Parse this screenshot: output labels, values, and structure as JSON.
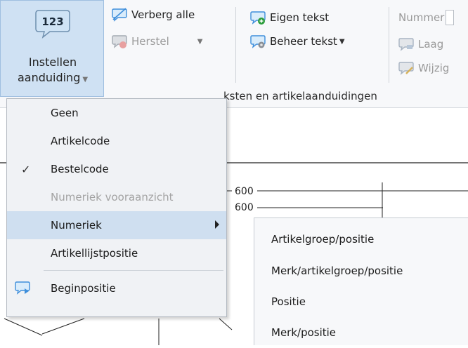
{
  "ribbon": {
    "big_button": {
      "icon_text": "123",
      "line1": "Instellen",
      "line2": "aanduiding"
    },
    "verberg_alle": "Verberg alle",
    "herstel": "Herstel",
    "eigen_tekst": "Eigen tekst",
    "beheer_tekst": "Beheer tekst",
    "nummer": "Nummer",
    "laag": "Laag",
    "wijzig": "Wijzig",
    "group_label": "ksten en artikelaanduidingen"
  },
  "menu": {
    "items": [
      {
        "label": "Geen"
      },
      {
        "label": "Artikelcode"
      },
      {
        "label": "Bestelcode",
        "checked": true
      },
      {
        "label": "Numeriek vooraanzicht",
        "disabled": true
      },
      {
        "label": "Numeriek",
        "submenu": true
      },
      {
        "label": "Artikellijstpositie"
      },
      {
        "label": "Beginpositie"
      }
    ]
  },
  "submenu": {
    "items": [
      {
        "label": "Artikelgroep/positie"
      },
      {
        "label": "Merk/artikelgroep/positie"
      },
      {
        "label": "Positie"
      },
      {
        "label": "Merk/positie"
      }
    ]
  },
  "drawing": {
    "dim1": "600",
    "dim2": "600"
  },
  "colors": {
    "highlight": "#cfdff0",
    "ribbon_selected": "#cfe1f3",
    "icon_blue": "#3e8edb"
  }
}
